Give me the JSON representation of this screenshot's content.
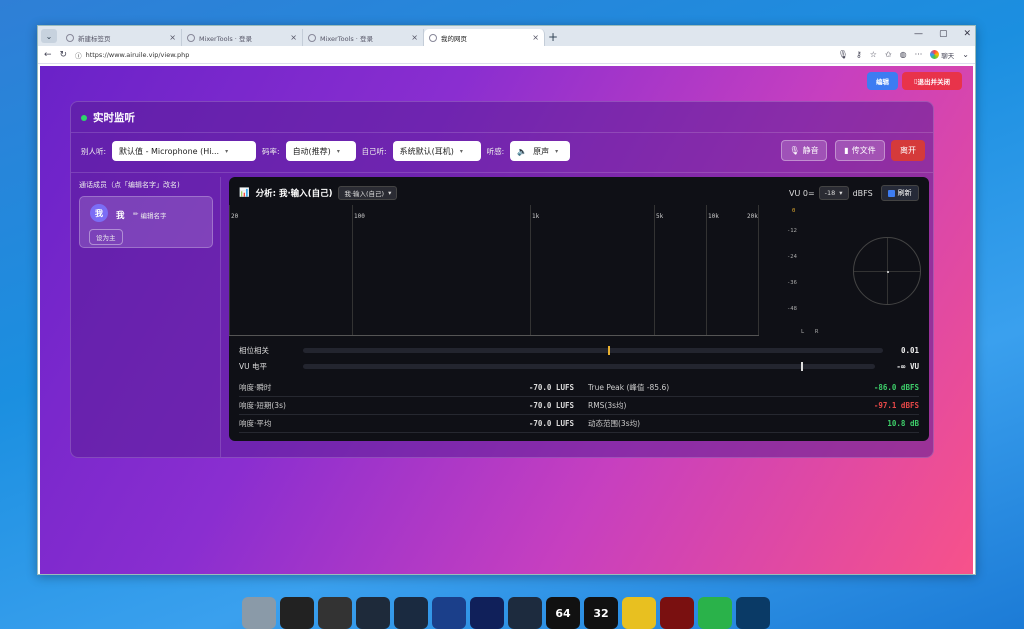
{
  "browser": {
    "tabs": [
      {
        "label": "新建标签页"
      },
      {
        "label": "MixerTools · 登录"
      },
      {
        "label": "MixerTools · 登录"
      },
      {
        "label": "我的网页"
      }
    ],
    "url": "https://www.airuile.vip/view.php",
    "profile_label": "聊天"
  },
  "page": {
    "edit_label": "编辑",
    "exit_label": "退出并关闭",
    "title": "实时监听",
    "controls": {
      "others_hear_label": "别人听:",
      "others_hear_value": "默认值 - Microphone (Hi...",
      "bitrate_label": "码率:",
      "bitrate_value": "自动(推荐)",
      "self_hear_label": "自己听:",
      "self_hear_value": "系统默认(耳机)",
      "listen_label": "听感:",
      "listen_value": "原声",
      "mute_label": "静音",
      "send_file_label": "传文件",
      "leave_label": "离开"
    },
    "members": {
      "header": "通话成员（点「编辑名字」改名)",
      "list": [
        {
          "avatar": "我",
          "name": "我",
          "edit_label": "编辑名字",
          "set_main_label": "设为主"
        }
      ]
    },
    "analyzer": {
      "title": "分析: 我·输入(自己)",
      "source_value": "我·输入(自己)",
      "vu_label": "VU 0=",
      "vu_value": "-18",
      "vu_unit": "dBFS",
      "refresh_label": "刷新",
      "freq_labels": [
        "20",
        "100",
        "1k",
        "5k",
        "10k",
        "20k"
      ],
      "db_labels": [
        "0",
        "-12",
        "-24",
        "-36",
        "-48"
      ],
      "lr_labels": [
        "L",
        "R"
      ],
      "phase_label": "相位相关",
      "phase_value": "0.01",
      "vu_meter_label": "VU 电平",
      "vu_meter_value": "-∞ VU",
      "stats": [
        {
          "label": "响度·瞬时",
          "value": "-70.0 LUFS",
          "label2": "True Peak (峰值 -85.6)",
          "value2": "-86.0 dBFS",
          "color2": "#3ecf6a"
        },
        {
          "label": "响度·短期(3s)",
          "value": "-70.0 LUFS",
          "label2": "RMS(3s均)",
          "value2": "-97.1 dBFS",
          "color2": "#e84848"
        },
        {
          "label": "响度·平均",
          "value": "-70.0 LUFS",
          "label2": "动态范围(3s均)",
          "value2": "10.8 dB",
          "color2": "#3ecf6a"
        }
      ]
    }
  },
  "taskbar": {
    "apps": [
      {
        "icon": "app-1-icon",
        "label": ""
      },
      {
        "icon": "app-2-icon",
        "label": ""
      },
      {
        "icon": "app-3-icon",
        "label": ""
      },
      {
        "icon": "app-4-icon",
        "label": ""
      },
      {
        "icon": "app-5-icon",
        "label": ""
      },
      {
        "icon": "app-6-icon",
        "label": ""
      },
      {
        "icon": "fender-studio-icon",
        "label": ""
      },
      {
        "icon": "cubase-icon",
        "label": ""
      },
      {
        "icon": "64bit-icon",
        "label": "64"
      },
      {
        "icon": "32bit-icon",
        "label": "32"
      },
      {
        "icon": "notes-icon",
        "label": ""
      },
      {
        "icon": "recorder-icon",
        "label": ""
      },
      {
        "icon": "wechat-icon",
        "label": ""
      },
      {
        "icon": "media-icon",
        "label": ""
      }
    ]
  }
}
